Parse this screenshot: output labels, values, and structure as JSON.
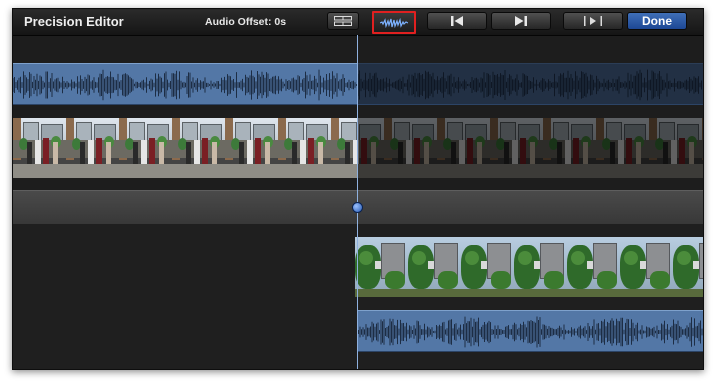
{
  "window": {
    "title": "Precision Editor"
  },
  "toolbar": {
    "audio_offset": "Audio Offset: 0s",
    "done_label": "Done",
    "icons": {
      "clips": "clip-list-icon",
      "waveform": "audio-waveform-icon",
      "previous": "skip-previous-icon",
      "next": "skip-next-icon",
      "play_selection": "play-selection-icon"
    },
    "highlight_color": "#e02020"
  },
  "colors": {
    "audio_waveform": "#5377a6",
    "playhead": "#8fb1df",
    "done_button": "#2a57a3"
  }
}
